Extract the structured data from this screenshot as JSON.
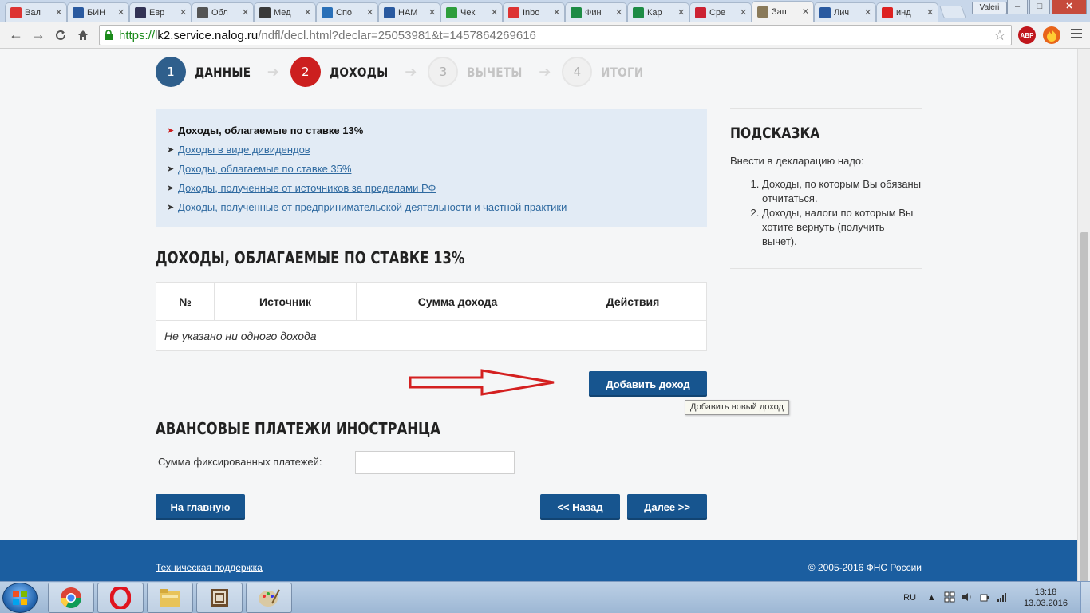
{
  "browser": {
    "tabs": [
      {
        "label": "Вал",
        "favicon_color": "#d33",
        "icon": "russia-flag-icon"
      },
      {
        "label": "БИН",
        "favicon_color": "#2a5aa0",
        "icon": "globe-icon"
      },
      {
        "label": "Евр",
        "favicon_color": "#335",
        "icon": "euro-icon"
      },
      {
        "label": "Обл",
        "favicon_color": "#555",
        "icon": "money-bag-icon"
      },
      {
        "label": "Мед",
        "favicon_color": "#3a3a3a",
        "icon": "circle-icon"
      },
      {
        "label": "Спо",
        "favicon_color": "#2a70b8",
        "icon": "search-icon"
      },
      {
        "label": "НАМ",
        "favicon_color": "#2a5aa0",
        "icon": "cart-icon"
      },
      {
        "label": "Чек",
        "favicon_color": "#2e9e3c",
        "icon": "clover-icon"
      },
      {
        "label": "Inbo",
        "favicon_color": "#d33",
        "icon": "gmail-icon"
      },
      {
        "label": "Фин",
        "favicon_color": "#1e8c45",
        "icon": "sheet-icon"
      },
      {
        "label": "Кар",
        "favicon_color": "#1e8c45",
        "icon": "sheet-icon"
      },
      {
        "label": "Сре",
        "favicon_color": "#c23",
        "icon": "bank-icon"
      },
      {
        "label": "Зап",
        "favicon_color": "#8a7a5a",
        "icon": "emblem-icon",
        "active": true
      },
      {
        "label": "Лич",
        "favicon_color": "#2a5aa0",
        "icon": "russia-flag-icon"
      },
      {
        "label": "инд",
        "favicon_color": "#d22",
        "icon": "yandex-icon"
      }
    ],
    "user_badge": "Valeri",
    "url": {
      "scheme": "https://",
      "host": "lk2.service.nalog.ru",
      "path": "/ndfl/decl.html?declar=25053981&t=1457864269616"
    },
    "extensions": {
      "abp": "ABP"
    }
  },
  "steps": [
    {
      "num": "1",
      "label": "ДАННЫЕ",
      "state": "done"
    },
    {
      "num": "2",
      "label": "ДОХОДЫ",
      "state": "current"
    },
    {
      "num": "3",
      "label": "ВЫЧЕТЫ",
      "state": "future"
    },
    {
      "num": "4",
      "label": "ИТОГИ",
      "state": "future"
    }
  ],
  "income_types": {
    "current": "Доходы, облагаемые по ставке 13%",
    "links": [
      "Доходы в виде дивидендов",
      "Доходы, облагаемые по ставке 35%",
      "Доходы, полученные от источников за пределами РФ",
      "Доходы, полученные от предпринимательской деятельности и частной практики"
    ]
  },
  "income_section": {
    "title": "ДОХОДЫ, ОБЛАГАЕМЫЕ ПО СТАВКЕ 13%",
    "columns": [
      "№",
      "Источник",
      "Сумма дохода",
      "Действия"
    ],
    "empty_text": "Не указано ни одного дохода",
    "add_button": "Добавить доход",
    "add_tooltip": "Добавить новый доход"
  },
  "advance_section": {
    "title": "АВАНСОВЫЕ ПЛАТЕЖИ ИНОСТРАНЦА",
    "field_label": "Сумма фиксированных платежей:",
    "field_value": ""
  },
  "nav_buttons": {
    "home": "На главную",
    "back": "<< Назад",
    "next": "Далее >>"
  },
  "hint": {
    "title": "ПОДСКАЗКА",
    "intro": "Внести в декларацию надо:",
    "items": [
      "Доходы, по которым Вы обязаны отчитаться.",
      "Доходы, налоги по которым Вы хотите вернуть (получить вычет)."
    ]
  },
  "footer": {
    "support_link": "Техническая поддержка",
    "copyright": "© 2005-2016 ФНС России"
  },
  "taskbar": {
    "language": "RU",
    "time": "13:18",
    "date": "13.03.2016"
  },
  "colors": {
    "primary_button": "#17558f",
    "step_done": "#2f5f8c",
    "step_current": "#cc1f1f",
    "footer": "#1b5ea0",
    "annotation_arrow": "#d42020"
  }
}
